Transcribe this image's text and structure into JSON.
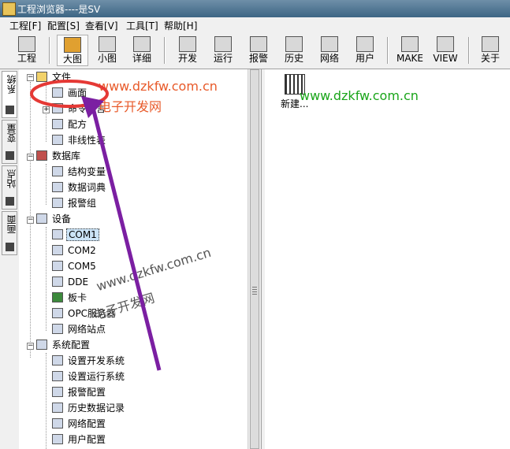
{
  "window": {
    "title": "工程浏览器----是SV"
  },
  "menu": [
    "工程[F]",
    "配置[S]",
    "查看[V]",
    "工具[T]",
    "帮助[H]"
  ],
  "toolbar": {
    "project": "工程",
    "large": "大图",
    "small": "小图",
    "detail": "详细",
    "develop": "开发",
    "run": "运行",
    "alarm": "报警",
    "history": "历史",
    "network": "网络",
    "user": "用户",
    "make": "MAKE",
    "view": "VIEW",
    "about": "关于"
  },
  "side_tabs": [
    "系统",
    "变量",
    "站点",
    "画面"
  ],
  "tree": {
    "file": "文件",
    "screen": "画面",
    "command": "命令语言",
    "recipe": "配方",
    "nonlinear": "非线性表",
    "database": "数据库",
    "struct_var": "结构变量",
    "data_dict": "数据词典",
    "alarm_group": "报警组",
    "device": "设备",
    "com1": "COM1",
    "com2": "COM2",
    "com5": "COM5",
    "dde": "DDE",
    "board": "板卡",
    "opc": "OPC服务器",
    "net_station": "网络站点",
    "sys_config": "系统配置",
    "dev_sys": "设置开发系统",
    "run_sys": "设置运行系统",
    "alarm_cfg": "报警配置",
    "history_rec": "历史数据记录",
    "net_cfg": "网络配置",
    "user_cfg": "用户配置"
  },
  "content": {
    "new_item": "新建..."
  },
  "watermarks": {
    "url": "www.dzkfw.com.cn",
    "cn": "电子开发网"
  },
  "colors": {
    "annotation": "#7b1fa2",
    "circle": "#e53935",
    "green_wm": "#1aa51a",
    "red_wm": "#e85a2a"
  }
}
